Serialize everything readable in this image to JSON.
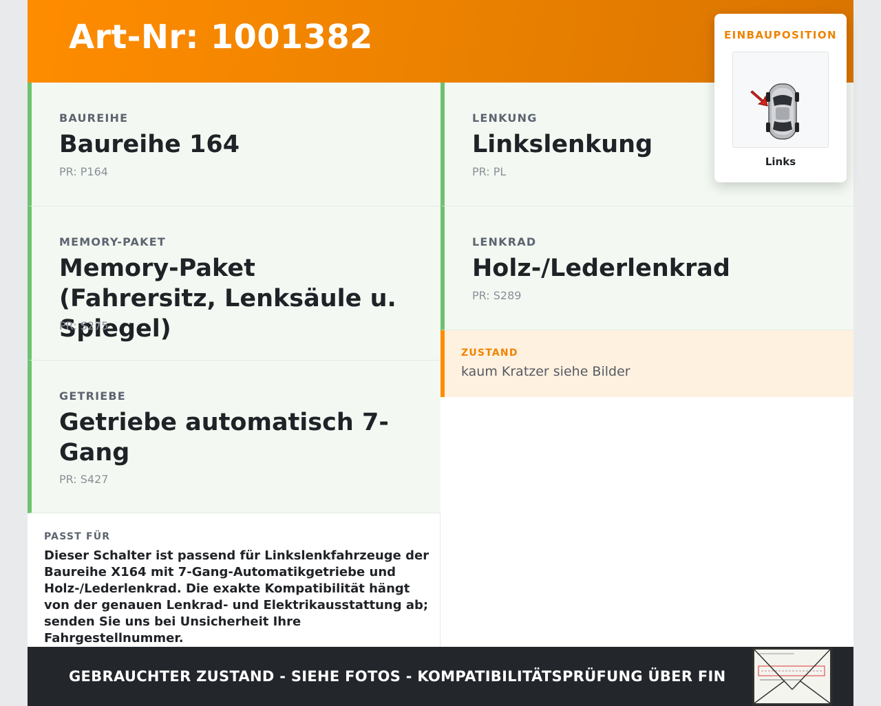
{
  "header": {
    "title": "Art-Nr: 1001382"
  },
  "cards_left": [
    {
      "label": "BAUREIHE",
      "value": "Baureihe 164",
      "pr": "PR: P164"
    },
    {
      "label": "MEMORY-PAKET",
      "value": "Memory-Paket (Fahrersitz, Lenksäule u. Spiegel)",
      "pr": "PR: S275"
    },
    {
      "label": "GETRIEBE",
      "value": "Getriebe automatisch 7-Gang",
      "pr": "PR: S427"
    }
  ],
  "cards_right": [
    {
      "label": "LENKUNG",
      "value": "Linkslenkung",
      "pr": "PR: PL"
    },
    {
      "label": "LENKRAD",
      "value": "Holz-/Lederlenkrad",
      "pr": "PR: S289"
    }
  ],
  "zustand": {
    "label": "ZUSTAND",
    "text": "kaum Kratzer siehe Bilder"
  },
  "passt_fuer": {
    "label": "PASST FÜR",
    "text": "Dieser Schalter ist passend für Linkslenkfahrzeuge der Baureihe X164 mit 7-Gang-Automatikgetriebe und Holz-/Lederlenkrad. Die exakte Kompatibilität hängt von der genauen Lenkrad- und Elektrikausstattung ab; senden Sie uns bei Unsicherheit Ihre Fahrgestellnummer."
  },
  "einbauposition": {
    "label": "EINBAUPOSITION",
    "position": "Links",
    "icon": "car-top-view-icon"
  },
  "footer": {
    "text": "GEBRAUCHTER ZUSTAND - SIEHE FOTOS - KOMPATIBILITÄTSPRÜFUNG ÜBER FIN"
  },
  "colors": {
    "accent": "#ff8c00",
    "green_border": "#6ec26f",
    "card_bg": "#f3f9f2",
    "footer_bg": "#23262b"
  }
}
